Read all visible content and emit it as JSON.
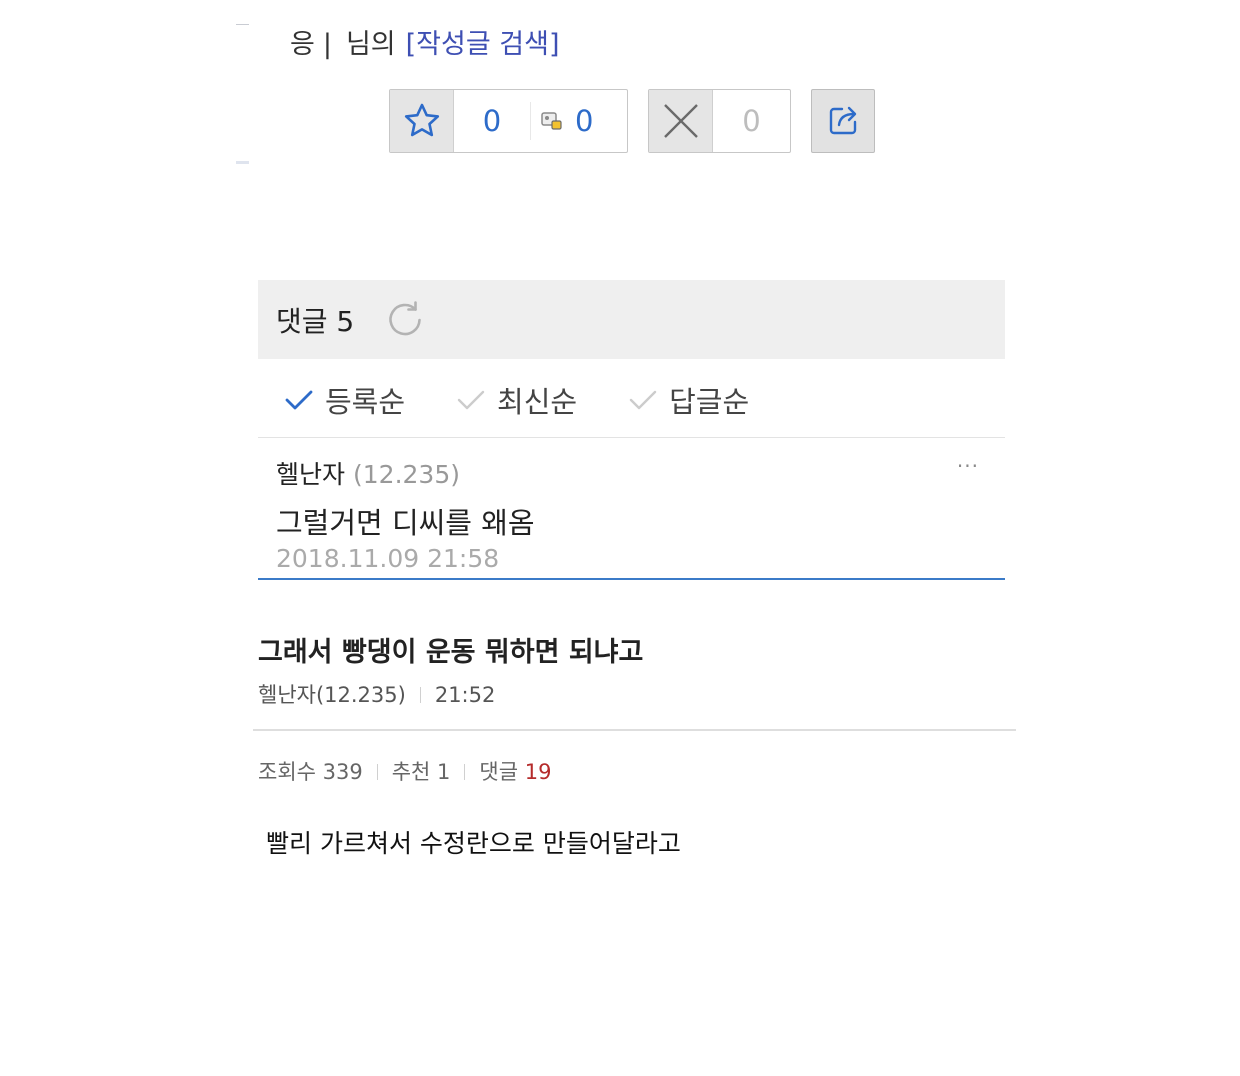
{
  "author_line": {
    "nick": "응",
    "separator": "|",
    "suffix": "님의",
    "search_link": "[작성글 검색]"
  },
  "votes": {
    "up_count": "0",
    "fixed_up_count": "0",
    "down_count": "0"
  },
  "comments": {
    "header": "댓글 5",
    "sort_options": [
      "등록순",
      "최신순",
      "답글순"
    ],
    "active_sort_index": 0,
    "items": [
      {
        "author": "헬난자",
        "ip": "(12.235)",
        "text": "그럴거면 디씨를 왜옴",
        "date": "2018.11.09 21:58",
        "more": "···"
      }
    ]
  },
  "post": {
    "title": "그래서 빵댕이 운동 뭐하면 되냐고",
    "author": "헬난자(12.235)",
    "time": "21:52",
    "views_label": "조회수 339",
    "recommend_label": "추천 1",
    "comments_label": "댓글",
    "comments_count": "19",
    "body": "빨리 가르쳐서 수정란으로 만들어달라고"
  },
  "colors": {
    "accent_blue": "#2d6bc9",
    "link_blue": "#3e4fb3",
    "underline_blue": "#3b7bc8",
    "comment_count_red": "#b52b2b"
  }
}
